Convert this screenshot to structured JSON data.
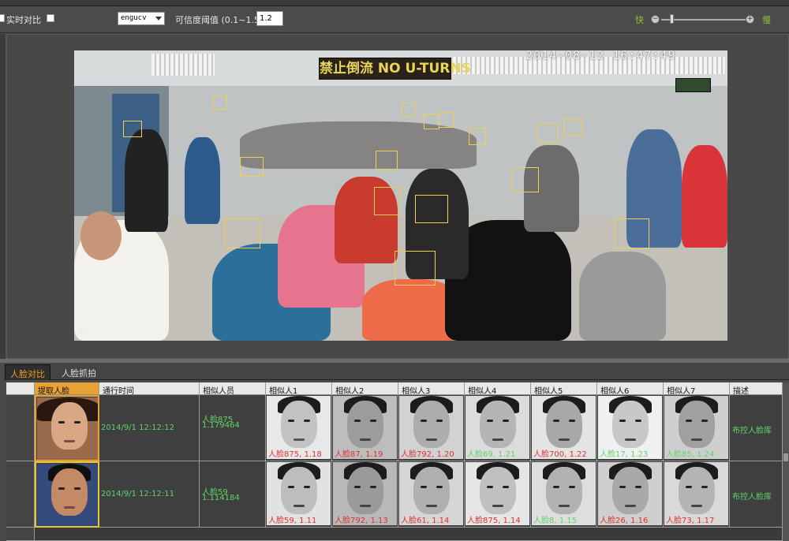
{
  "toolbar": {
    "realtime_label": "实时对比",
    "algorithm_value": "engucv",
    "threshold_label": "可信度阈值 (0.1~1.5)",
    "threshold_value": "1.2",
    "slow_label": "快",
    "fast_label": "慢"
  },
  "video": {
    "timestamp": "2014-08-12 16:47:49",
    "sign_text": "禁止倒流 NO U-TURNS",
    "camera_label": "IPC"
  },
  "tabs": [
    {
      "label": "人脸对比",
      "active": true
    },
    {
      "label": "人脸抓拍",
      "active": false
    }
  ],
  "table": {
    "headers": [
      "提取人脸",
      "通行时间",
      "相似人员",
      "相似人1",
      "相似人2",
      "相似人3",
      "相似人4",
      "相似人5",
      "相似人6",
      "相似人7",
      "描述"
    ],
    "rows": [
      {
        "time": "2014/9/1 12:12:12",
        "similar_person": "人脸875",
        "similar_score": "1.179464",
        "matches": [
          "人脸875, 1.18",
          "人脸87, 1.19",
          "人脸792, 1.20",
          "人脸69, 1.21",
          "人脸700, 1.22",
          "人脸17, 1.23",
          "人脸85, 1.24"
        ],
        "description": "布控人脸库"
      },
      {
        "time": "2014/9/1 12:12:11",
        "similar_person": "人脸59",
        "similar_score": "1.114184",
        "matches": [
          "人脸59, 1.11",
          "人脸792, 1.13",
          "人脸61, 1.14",
          "人脸875, 1.14",
          "人脸8, 1.15",
          "人脸26, 1.16",
          "人脸73, 1.17"
        ],
        "description": "布控人脸库"
      }
    ]
  },
  "colors": {
    "accent": "#f29b21",
    "green_text": "#5fd46a",
    "red_text": "#e03030",
    "face_box": "#f0d050"
  }
}
